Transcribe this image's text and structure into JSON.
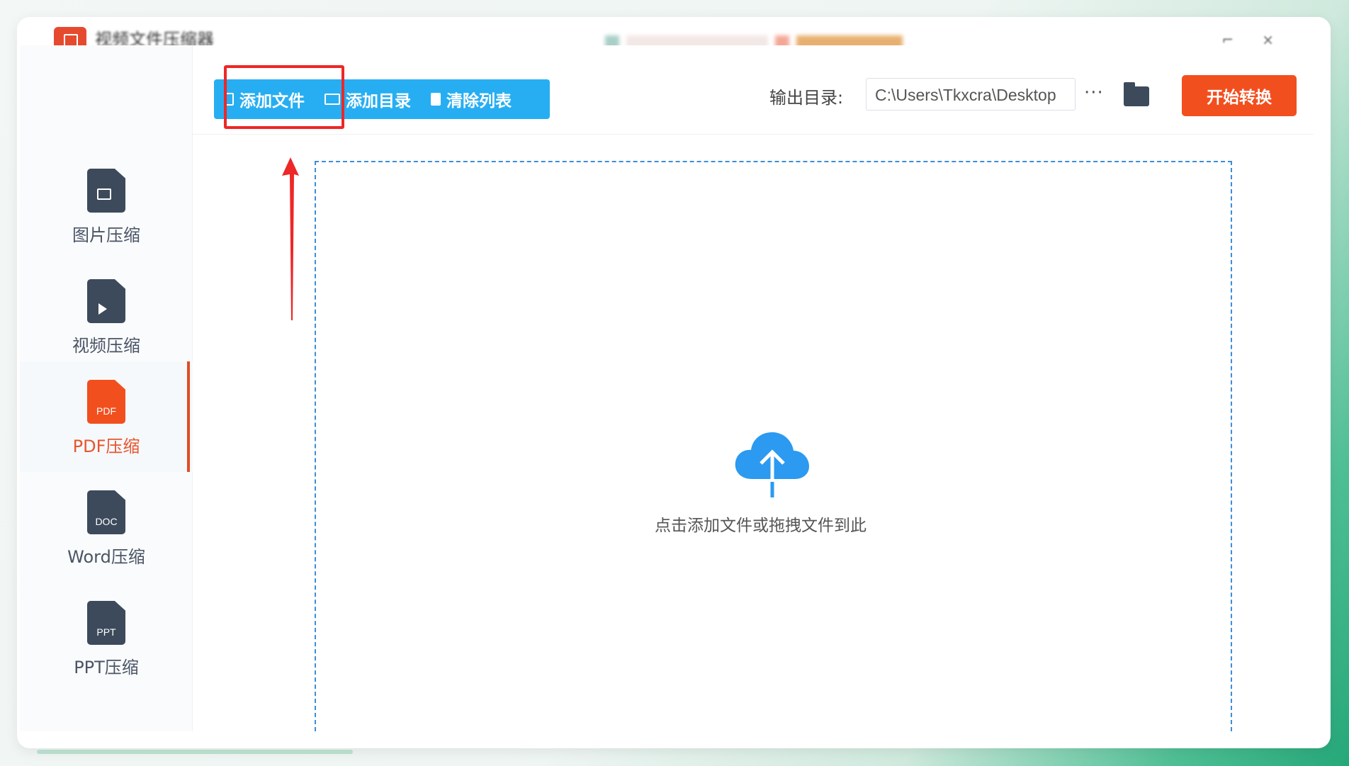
{
  "colors": {
    "accent_blue": "#27aef2",
    "accent_orange": "#f24f1f",
    "annotation_red": "#ee2727",
    "icon_dark": "#3d4a5c"
  },
  "titlebar": {
    "app_title": "视频文件压缩器",
    "logo_icon": "app-logo-icon"
  },
  "sidebar": {
    "items": [
      {
        "label": "图片压缩",
        "icon": "image-file-icon",
        "tag": ""
      },
      {
        "label": "视频压缩",
        "icon": "video-file-icon",
        "tag": ""
      },
      {
        "label": "PDF压缩",
        "icon": "pdf-file-icon",
        "tag": "PDF",
        "active": true
      },
      {
        "label": "Word压缩",
        "icon": "doc-file-icon",
        "tag": "DOC"
      },
      {
        "label": "PPT压缩",
        "icon": "ppt-file-icon",
        "tag": "PPT"
      }
    ]
  },
  "toolbar": {
    "add_file_label": "添加文件",
    "add_folder_label": "添加目录",
    "clear_list_label": "清除列表",
    "output_label": "输出目录:",
    "output_path": "C:\\Users\\Tkxcra\\Desktop",
    "more_label": "···",
    "start_label": "开始转换"
  },
  "drop_zone": {
    "hint": "点击添加文件或拖拽文件到此"
  }
}
